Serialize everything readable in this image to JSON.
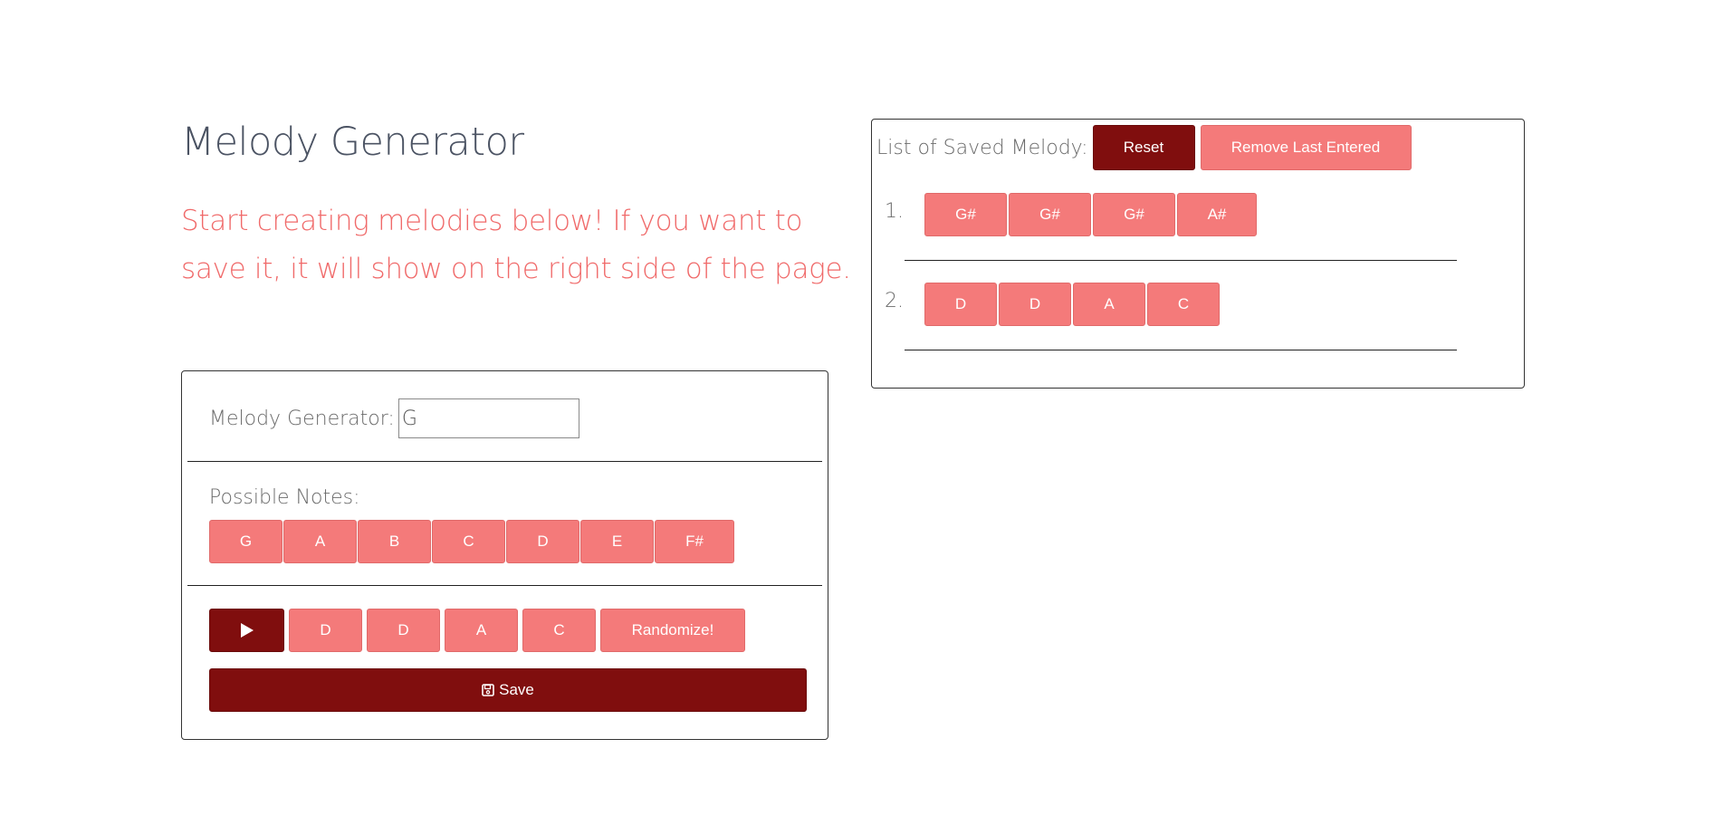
{
  "header": {
    "title": "Melody Generator",
    "intro": "Start creating melodies below! If you want to save it, it will show on the right side of the page."
  },
  "generator": {
    "key_label": "Melody Generator:",
    "key_value": "G",
    "possible_label": "Possible Notes:",
    "possible_notes": [
      "G",
      "A",
      "B",
      "C",
      "D",
      "E",
      "F#"
    ],
    "play_icon": "play-icon",
    "current_melody": [
      "D",
      "D",
      "A",
      "C"
    ],
    "randomize_label": "Randomize!",
    "save_icon": "save-icon",
    "save_label": "Save"
  },
  "saved": {
    "label": "List of Saved Melody:",
    "reset_label": "Reset",
    "remove_label": "Remove Last Entered",
    "melodies": [
      {
        "number": "1.",
        "notes": [
          "G#",
          "G#",
          "G#",
          "A#"
        ]
      },
      {
        "number": "2.",
        "notes": [
          "D",
          "D",
          "A",
          "C"
        ]
      }
    ]
  },
  "colors": {
    "accent": "#f47a7a",
    "dark_accent": "#800e0e",
    "intro_text": "#f06a6a",
    "title_text": "#4b5363"
  }
}
